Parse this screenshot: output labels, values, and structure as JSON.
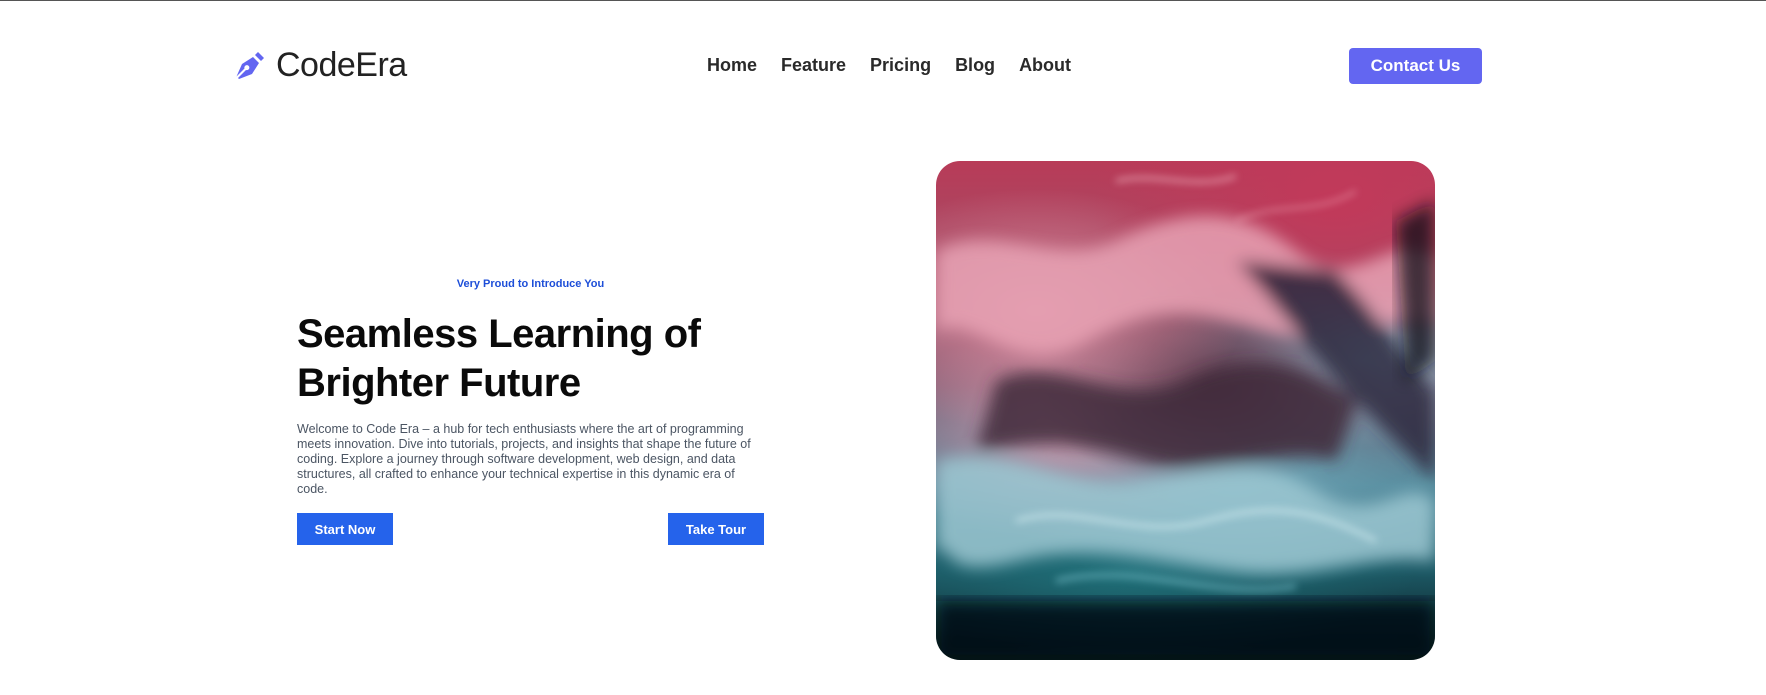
{
  "brand": {
    "name": "CodeEra",
    "accent_color": "#6366f1",
    "logo_icon": "pen-nib-icon"
  },
  "nav": {
    "items": [
      {
        "label": "Home"
      },
      {
        "label": "Feature"
      },
      {
        "label": "Pricing"
      },
      {
        "label": "Blog"
      },
      {
        "label": "About"
      }
    ]
  },
  "header": {
    "contact_label": "Contact Us"
  },
  "hero": {
    "eyebrow": "Very Proud to Introduce You",
    "title": "Seamless Learning of Brighter Future",
    "description": "Welcome to Code Era – a hub for tech enthusiasts where the art of programming meets innovation. Dive into tutorials, projects, and insights that shape the future of coding. Explore a journey through software development, web design, and data structures, all crafted to enhance your technical expertise in this dynamic era of code.",
    "primary_button": "Start Now",
    "secondary_button": "Take Tour",
    "button_color": "#2563eb",
    "image_subject": "abstract ink fluid art in pink, red and teal"
  }
}
